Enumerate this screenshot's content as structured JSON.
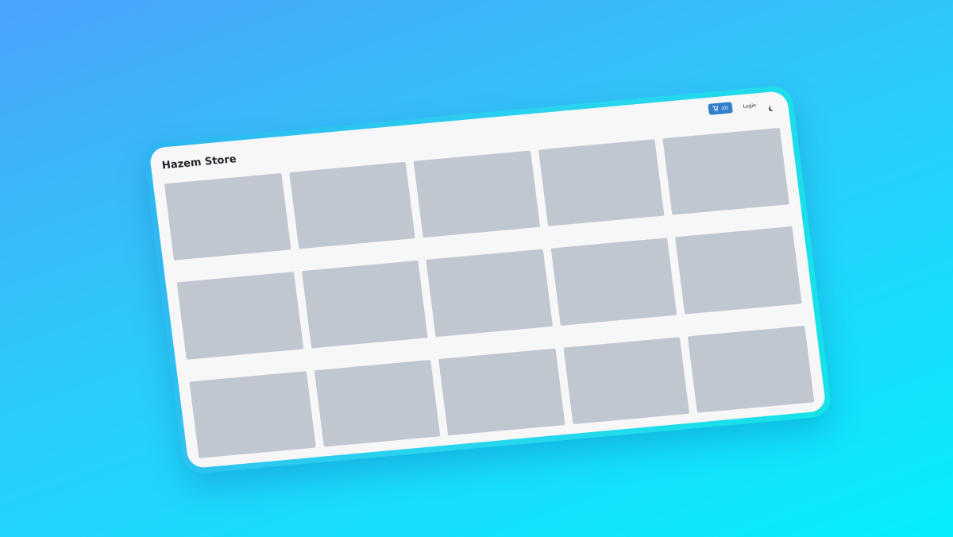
{
  "navbar": {
    "brand": "Hazem Store",
    "cart_count": "(0)",
    "cart_icon": "cart-icon",
    "login_label": "Login",
    "theme_icon": "moon-icon"
  },
  "products": {
    "placeholder_count": 15,
    "placeholder_color": "#c1c7d1"
  },
  "colors": {
    "accent": "#2f7fc9",
    "screen_bg": "#f7f7f8",
    "frame": "#2ad3ee"
  }
}
